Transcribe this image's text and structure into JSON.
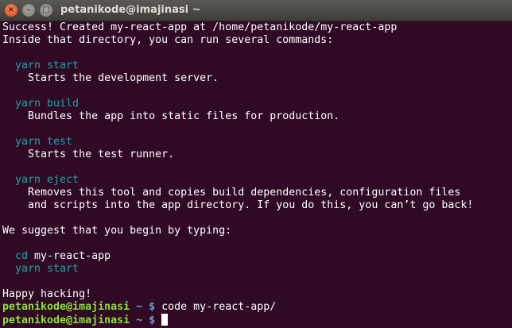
{
  "window": {
    "title": "petanikode@imajinasi ~",
    "close_label": "×",
    "min_label": "–",
    "max_label": "□"
  },
  "lines": [
    {
      "text": "Success! Created my-react-app at /home/petanikode/my-react-app"
    },
    {
      "text": "Inside that directory, you can run several commands:"
    },
    {
      "text": ""
    },
    {
      "cmd": "  yarn start"
    },
    {
      "text": "    Starts the development server."
    },
    {
      "text": ""
    },
    {
      "cmd": "  yarn build"
    },
    {
      "text": "    Bundles the app into static files for production."
    },
    {
      "text": ""
    },
    {
      "cmd": "  yarn test"
    },
    {
      "text": "    Starts the test runner."
    },
    {
      "text": ""
    },
    {
      "cmd": "  yarn eject"
    },
    {
      "text": "    Removes this tool and copies build dependencies, configuration files"
    },
    {
      "text": "    and scripts into the app directory. If you do this, you can’t go back!"
    },
    {
      "text": ""
    },
    {
      "text": "We suggest that you begin by typing:"
    },
    {
      "text": ""
    },
    {
      "cmd": "  cd",
      "rest": " my-react-app"
    },
    {
      "cmd": "  yarn start"
    },
    {
      "text": ""
    },
    {
      "text": "Happy hacking!"
    }
  ],
  "prompts": [
    {
      "user": "petanikode@imajinasi",
      "path": " ~ $",
      "command": " code my-react-app/"
    },
    {
      "user": "petanikode@imajinasi",
      "path": " ~ $",
      "command": " "
    }
  ],
  "colors": {
    "background": "#300a24",
    "command": "#1aa6a6",
    "prompt_user": "#8ae234",
    "prompt_path": "#729fcf"
  }
}
